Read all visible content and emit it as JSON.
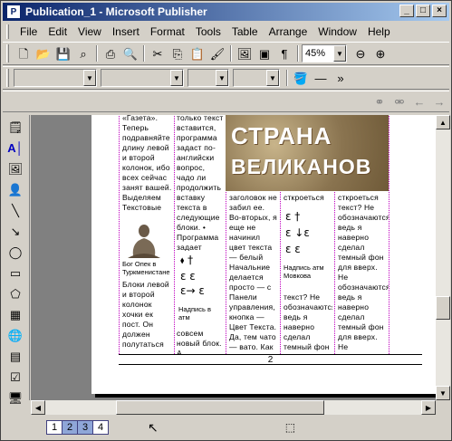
{
  "window": {
    "title": "Publication_1 - Microsoft Publisher",
    "app_icon": "P",
    "controls": [
      "_",
      "□",
      "×"
    ]
  },
  "menu": [
    "File",
    "Edit",
    "View",
    "Insert",
    "Format",
    "Tools",
    "Table",
    "Arrange",
    "Window",
    "Help"
  ],
  "toolbar_standard": {
    "zoom": "45%"
  },
  "document": {
    "banner_line1": "СТРАНА",
    "banner_line2": "ВЕЛИКАНОВ",
    "col1_text": "«Газета». Теперь подравняйте длину левой и второй колонок, ибо всех сейчас занят вашей. Выделяем Текстовые",
    "col1_caption": "Бог Опек в Туркменистане",
    "col1_text2": "Блоки левой и второй колонок хочки ек пост. Он должен полутаться одна ко-",
    "col2_text": "только текст вставится, программа задаст по-английски вопрос, чадо ли продолжить вставку текста в следующие блоки. • Программа задает также вопросы тогда, когда вы создаете",
    "col2_caption": "Надпись в атм",
    "col2_text2": "совсем новый блок. А",
    "col3_text": "заголовок не забил ее. Во-вторых, я еще не начинил цвет текста — белый Начальние делается просто — с Панели управления, кнопка — Цвет Текста. Да, тем чато — вато. Как же на такое фоне будет",
    "col4_text": "сткроеться",
    "col4_caption": "Надпись атм Мовкова",
    "col4_text2": "текст? Не обозначаются: ведь я наверно сделал темный фон",
    "col5_text": "сткроеться текст? Не обозначаются: ведь я наверно сделал темный фон для вверх. Не обозначаются: ведь я наверно сделал темный фон для вверх. Не обозначаются: ведь я наверно сделал темный фон.",
    "page_number": "2"
  },
  "status": {
    "pages": [
      "1",
      "2",
      "3",
      "4"
    ],
    "current_pages": [
      "2",
      "3"
    ]
  }
}
